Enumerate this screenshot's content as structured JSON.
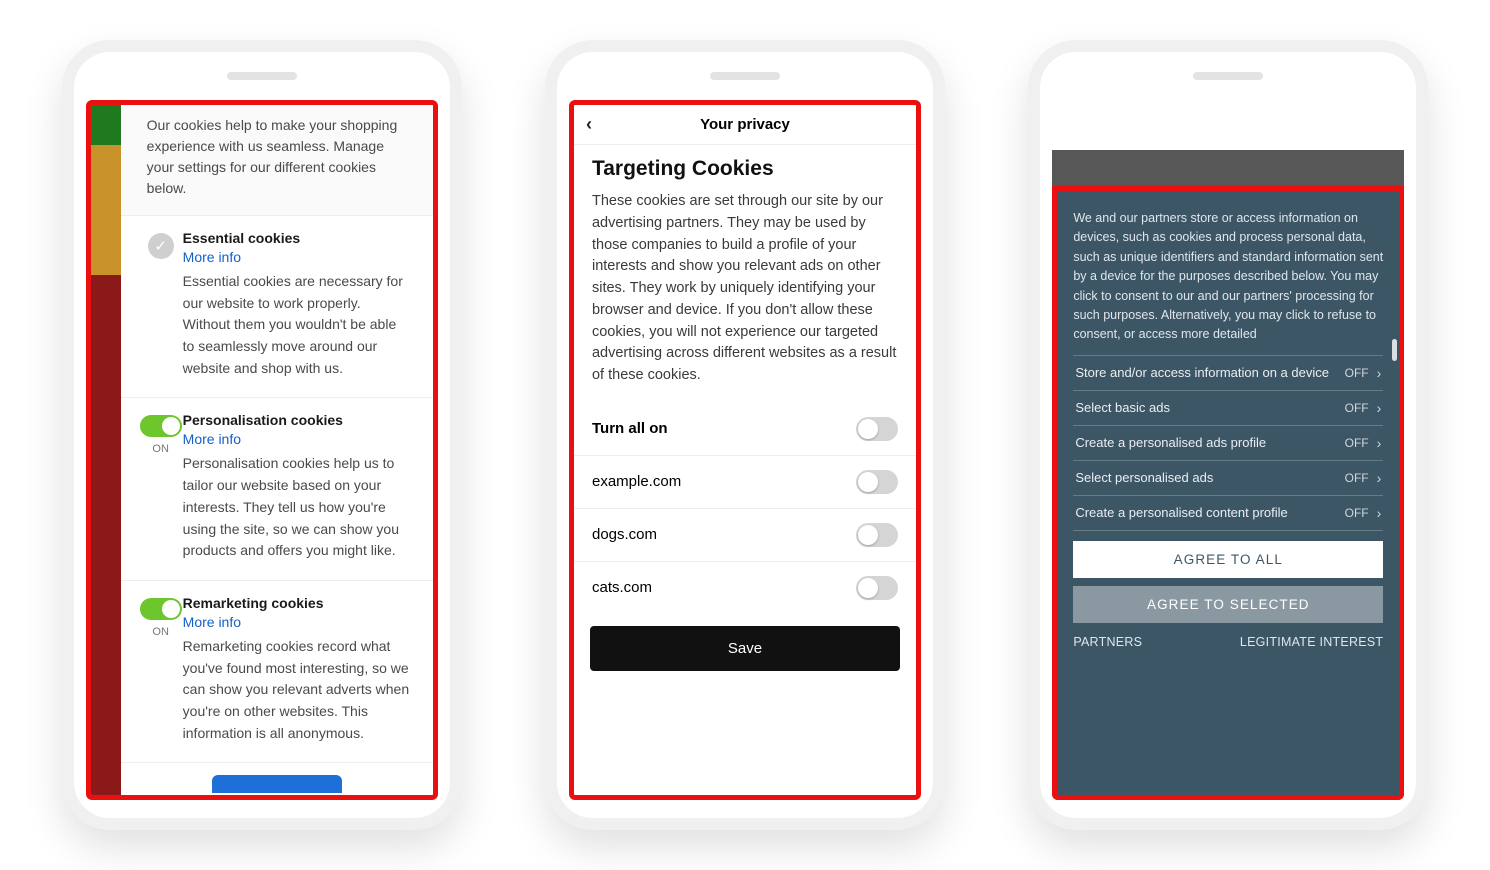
{
  "phone1": {
    "intro": "Our cookies help to make your shopping experience with us seamless. Manage your settings for our different cookies below.",
    "sections": [
      {
        "title": "Essential cookies",
        "link": "More info",
        "desc": "Essential cookies are necessary for our website to work properly. Without them you wouldn't be able to seamlessly move around our website and shop with us.",
        "type": "check"
      },
      {
        "title": "Personalisation cookies",
        "link": "More info",
        "desc": "Personalisation cookies help us to tailor our website based on your interests. They tell us how you're using the site, so we can show you products and offers you might like.",
        "type": "toggle",
        "state": "ON"
      },
      {
        "title": "Remarketing cookies",
        "link": "More info",
        "desc": "Remarketing cookies record what you've found most interesting, so we can show you relevant adverts when you're on other websites. This information is all anonymous.",
        "type": "toggle",
        "state": "ON"
      }
    ]
  },
  "phone2": {
    "header": "Your privacy",
    "title": "Targeting Cookies",
    "desc": "These cookies are set through our site by our advertising partners. They may be used by those companies to build a profile of your interests and show you relevant ads on other sites. They work by uniquely identifying your browser and device. If you don't allow these cookies, you will not experience our targeted advertising across different websites as a result of these cookies.",
    "rows": [
      {
        "label": "Turn all on"
      },
      {
        "label": "example.com"
      },
      {
        "label": "dogs.com"
      },
      {
        "label": "cats.com"
      }
    ],
    "save": "Save"
  },
  "phone3": {
    "intro": "We and our partners store or access information on devices, such as cookies and process personal data, such as unique identifiers and standard information sent by a device for the purposes described below. You may click to consent to our and our partners' processing for such purposes. Alternatively, you may click to refuse to consent, or access more detailed",
    "rows": [
      {
        "label": "Store and/or access information on a device",
        "state": "OFF"
      },
      {
        "label": "Select basic ads",
        "state": "OFF"
      },
      {
        "label": "Create a personalised ads profile",
        "state": "OFF"
      },
      {
        "label": "Select personalised ads",
        "state": "OFF"
      },
      {
        "label": "Create a personalised content profile",
        "state": "OFF"
      }
    ],
    "agree_all": "AGREE TO ALL",
    "agree_sel": "AGREE TO SELECTED",
    "partners": "PARTNERS",
    "legit": "LEGITIMATE INTEREST"
  }
}
